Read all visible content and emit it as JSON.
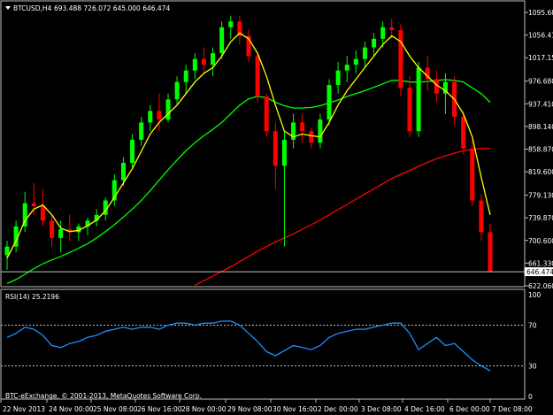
{
  "header": {
    "symbol": "BTCUSD,H4",
    "ohlc": "693.488 726.072 645.000 646.474"
  },
  "price_panel": {
    "y_ticks": [
      "1095.680",
      "1056.410",
      "1017.150",
      "976.680",
      "937.410",
      "898.140",
      "858.870",
      "819.600",
      "779.130",
      "739.870",
      "700.600",
      "661.330",
      "622.060"
    ],
    "y_min": 622.06,
    "y_max": 1095.68,
    "current_price_label": "646.474",
    "current_price": 646.474
  },
  "rsi_panel": {
    "label": "RSI(14) 25.2196",
    "levels": [
      "100",
      "70",
      "30",
      "0"
    ],
    "overbought": 70,
    "oversold": 30
  },
  "x_axis": {
    "labels": [
      "22 Nov 2013",
      "24 Nov 00:00",
      "25 Nov 08:00",
      "26 Nov 16:00",
      "28 Nov 00:00",
      "29 Nov 08:00",
      "30 Nov 16:00",
      "2 Dec 00:00",
      "3 Dec 08:00",
      "4 Dec 16:00",
      "6 Dec 00:00",
      "7 Dec 08:00"
    ]
  },
  "copyright": "BTC-eExchange, © 2001-2013, MetaQuotes Software Corp.",
  "colors": {
    "bull": "#00ff00",
    "bear": "#ff0000",
    "ma_fast": "#ffff00",
    "ma_mid": "#00ff00",
    "ma_slow": "#ff0000",
    "rsi": "#1e90ff",
    "grid": "#c0c0c0"
  },
  "chart_data": {
    "type": "candlestick",
    "series": [
      {
        "name": "candles",
        "values": [
          [
            675,
            700,
            650,
            690
          ],
          [
            690,
            735,
            680,
            725
          ],
          [
            725,
            785,
            715,
            765
          ],
          [
            765,
            800,
            745,
            760
          ],
          [
            760,
            790,
            725,
            735
          ],
          [
            735,
            745,
            690,
            705
          ],
          [
            705,
            735,
            680,
            720
          ],
          [
            720,
            745,
            700,
            715
          ],
          [
            715,
            730,
            700,
            725
          ],
          [
            725,
            740,
            710,
            735
          ],
          [
            735,
            755,
            725,
            745
          ],
          [
            745,
            775,
            735,
            770
          ],
          [
            770,
            815,
            760,
            805
          ],
          [
            805,
            845,
            795,
            835
          ],
          [
            835,
            885,
            825,
            875
          ],
          [
            875,
            915,
            865,
            905
          ],
          [
            905,
            935,
            890,
            925
          ],
          [
            925,
            955,
            890,
            910
          ],
          [
            910,
            955,
            905,
            945
          ],
          [
            945,
            985,
            935,
            975
          ],
          [
            975,
            1005,
            955,
            995
          ],
          [
            995,
            1025,
            980,
            1015
          ],
          [
            1015,
            1035,
            990,
            1005
          ],
          [
            1005,
            1035,
            985,
            1025
          ],
          [
            1025,
            1080,
            1015,
            1070
          ],
          [
            1070,
            1090,
            1050,
            1080
          ],
          [
            1080,
            1090,
            1040,
            1055
          ],
          [
            1055,
            1065,
            1010,
            1020
          ],
          [
            1020,
            1025,
            940,
            950
          ],
          [
            950,
            955,
            880,
            890
          ],
          [
            890,
            905,
            790,
            830
          ],
          [
            830,
            890,
            690,
            875
          ],
          [
            875,
            920,
            860,
            905
          ],
          [
            905,
            920,
            870,
            890
          ],
          [
            890,
            895,
            860,
            870
          ],
          [
            870,
            920,
            860,
            910
          ],
          [
            910,
            980,
            900,
            970
          ],
          [
            970,
            1010,
            955,
            995
          ],
          [
            995,
            1020,
            975,
            1005
          ],
          [
            1005,
            1030,
            990,
            1015
          ],
          [
            1015,
            1045,
            1000,
            1035
          ],
          [
            1035,
            1060,
            1020,
            1050
          ],
          [
            1050,
            1080,
            1035,
            1070
          ],
          [
            1070,
            1085,
            1050,
            1065
          ],
          [
            1065,
            1075,
            950,
            965
          ],
          [
            965,
            985,
            880,
            890
          ],
          [
            890,
            1010,
            880,
            1000
          ],
          [
            1000,
            1020,
            960,
            980
          ],
          [
            980,
            995,
            940,
            955
          ],
          [
            955,
            990,
            920,
            975
          ],
          [
            975,
            985,
            900,
            915
          ],
          [
            915,
            925,
            850,
            860
          ],
          [
            860,
            875,
            760,
            770
          ],
          [
            770,
            780,
            700,
            715
          ],
          [
            715,
            730,
            645,
            646.474
          ]
        ]
      },
      {
        "name": "ma_fast",
        "values": [
          670,
          700,
          735,
          755,
          762,
          745,
          722,
          716,
          718,
          726,
          736,
          752,
          775,
          800,
          825,
          855,
          885,
          905,
          920,
          935,
          955,
          975,
          990,
          1000,
          1020,
          1045,
          1060,
          1050,
          1025,
          985,
          935,
          890,
          880,
          885,
          882,
          880,
          905,
          935,
          960,
          980,
          1000,
          1020,
          1040,
          1055,
          1045,
          1020,
          1000,
          985,
          970,
          960,
          945,
          920,
          880,
          810,
          745
        ]
      },
      {
        "name": "ma_mid",
        "values": [
          626,
          633,
          642,
          652,
          660,
          667,
          673,
          680,
          687,
          695,
          705,
          716,
          728,
          741,
          755,
          770,
          787,
          805,
          823,
          840,
          856,
          870,
          882,
          893,
          905,
          920,
          935,
          946,
          950,
          948,
          940,
          934,
          930,
          930,
          931,
          934,
          939,
          944,
          950,
          955,
          960,
          966,
          972,
          978,
          978,
          975,
          975,
          976,
          978,
          979,
          978,
          975,
          965,
          955,
          940
        ]
      },
      {
        "name": "ma_slow",
        "values": [
          500,
          505,
          510,
          515,
          520,
          525,
          530,
          535,
          540,
          545,
          550,
          556,
          562,
          568,
          574,
          580,
          587,
          594,
          601,
          608,
          615,
          623,
          631,
          639,
          647,
          655,
          664,
          673,
          682,
          690,
          698,
          705,
          712,
          720,
          728,
          736,
          745,
          754,
          763,
          772,
          781,
          790,
          799,
          808,
          815,
          822,
          829,
          836,
          842,
          847,
          852,
          856,
          858,
          860,
          860
        ]
      },
      {
        "name": "RSI(14)",
        "values": [
          58,
          62,
          68,
          66,
          60,
          50,
          48,
          52,
          54,
          58,
          60,
          64,
          66,
          68,
          66,
          68,
          68,
          66,
          70,
          72,
          72,
          70,
          72,
          72,
          74,
          74,
          70,
          62,
          54,
          44,
          40,
          45,
          50,
          48,
          46,
          50,
          58,
          62,
          64,
          66,
          66,
          68,
          70,
          72,
          72,
          62,
          46,
          52,
          58,
          50,
          52,
          44,
          36,
          30,
          25.2196
        ]
      }
    ],
    "ylim": [
      622.06,
      1095.68
    ],
    "rsi_ylim": [
      0,
      100
    ]
  }
}
